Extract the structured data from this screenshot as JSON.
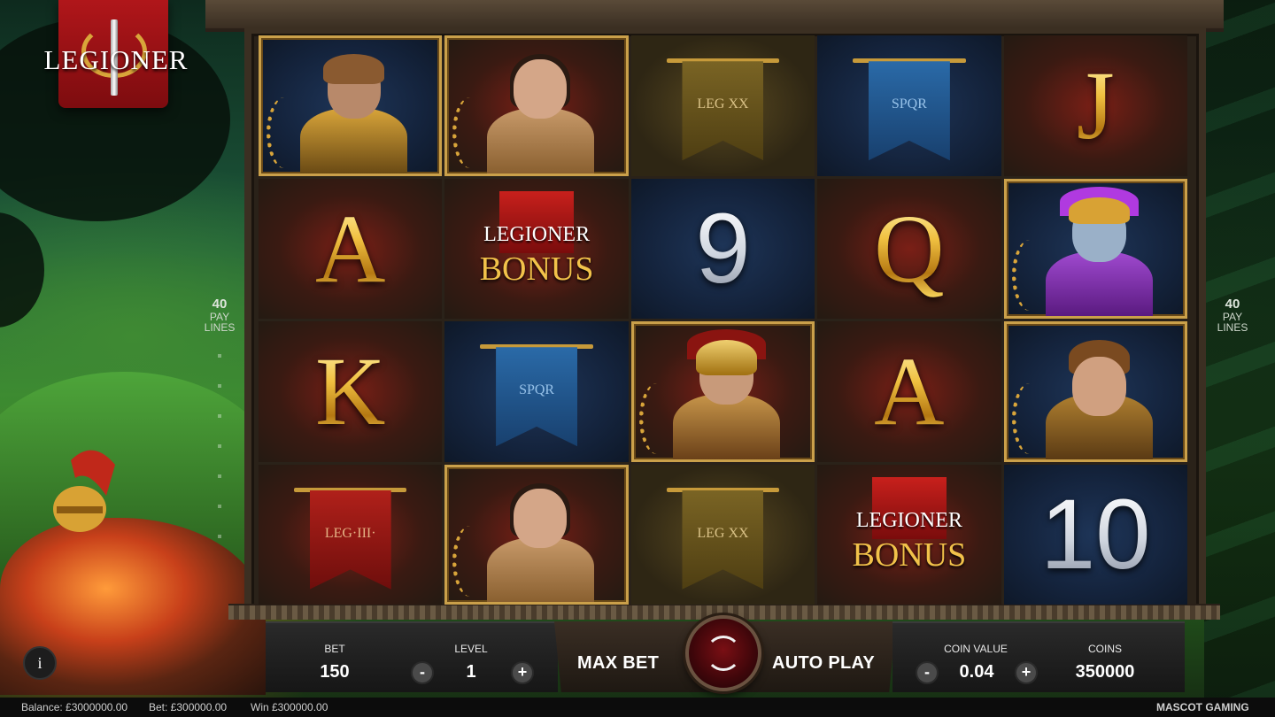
{
  "game": {
    "logo_text": "LEGIONER",
    "provider": "MASCOT GAMING"
  },
  "paylines": {
    "count": "40",
    "label_line1": "PAY",
    "label_line2": "LINES"
  },
  "reels": [
    [
      {
        "symbol": "eyepatch-warrior",
        "kind": "character"
      },
      {
        "symbol": "woman",
        "kind": "character"
      },
      {
        "symbol": "banner-leg-xx",
        "kind": "banner",
        "text": "LEG XX"
      },
      {
        "symbol": "banner-spqr",
        "kind": "banner",
        "text": "SPQR"
      },
      {
        "symbol": "J",
        "kind": "letter"
      }
    ],
    [
      {
        "symbol": "A",
        "kind": "letter"
      },
      {
        "symbol": "bonus",
        "kind": "bonus"
      },
      {
        "symbol": "9",
        "kind": "number"
      },
      {
        "symbol": "Q",
        "kind": "letter"
      },
      {
        "symbol": "purple-crest-legionary",
        "kind": "character"
      }
    ],
    [
      {
        "symbol": "K",
        "kind": "letter"
      },
      {
        "symbol": "banner-spqr",
        "kind": "banner",
        "text": "SPQR"
      },
      {
        "symbol": "gold-helmet-centurion",
        "kind": "character"
      },
      {
        "symbol": "A",
        "kind": "letter"
      },
      {
        "symbol": "young-soldier",
        "kind": "character"
      }
    ],
    [
      {
        "symbol": "banner-leg-iii",
        "kind": "banner",
        "text": "LEG·III·"
      },
      {
        "symbol": "woman",
        "kind": "character"
      },
      {
        "symbol": "banner-leg-xx",
        "kind": "banner",
        "text": "LEG XX"
      },
      {
        "symbol": "bonus",
        "kind": "bonus"
      },
      {
        "symbol": "10",
        "kind": "number"
      }
    ]
  ],
  "bonus_symbol": {
    "line1": "LEGIONER",
    "line2": "BONUS"
  },
  "letters": {
    "r0c4": "J",
    "r1c0": "A",
    "r1c2": "9",
    "r1c3": "Q",
    "r2c0": "K",
    "r2c3": "A",
    "r3c4": "10"
  },
  "banners": {
    "r0c2": "LEG XX",
    "r0c3": "SPQR",
    "r2c1": "SPQR",
    "r3c0": "LEG·III·",
    "r3c2": "LEG XX"
  },
  "controls": {
    "bet_label": "BET",
    "bet_value": "150",
    "level_label": "LEVEL",
    "level_value": "1",
    "max_bet": "MAX BET",
    "auto_play": "AUTO PLAY",
    "coin_value_label": "COIN VALUE",
    "coin_value": "0.04",
    "coins_label": "COINS",
    "coins_value": "350000",
    "minus": "-",
    "plus": "+",
    "info": "i"
  },
  "status": {
    "balance": "Balance: £3000000.00",
    "bet": "Bet: £300000.00",
    "win": "Win £300000.00"
  },
  "colors": {
    "gold": "#f0c040",
    "spin_red": "#7a0f14",
    "banner_red": "#b0161a"
  }
}
